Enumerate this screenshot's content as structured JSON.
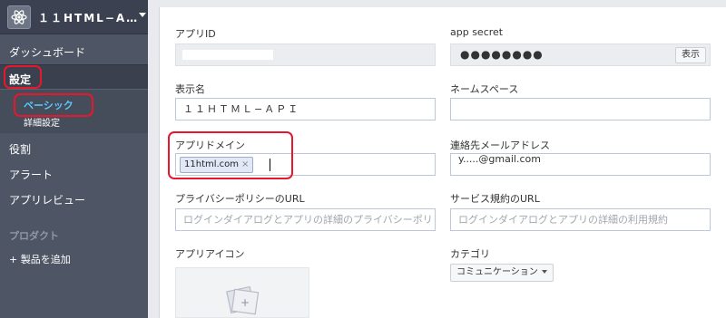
{
  "sidebar": {
    "app_name": "１１HTML−A…",
    "dashboard": "ダッシュボード",
    "settings": "設定",
    "settings_sub": [
      "ベーシック",
      "詳細設定"
    ],
    "roles": "役割",
    "alerts": "アラート",
    "app_review": "アプリレビュー",
    "products_header": "プロダクト",
    "add_product": "+ 製品を追加"
  },
  "form": {
    "app_id": {
      "label": "アプリID",
      "value": ""
    },
    "app_secret": {
      "label": "app secret",
      "value": "●●●●●●●●",
      "show_button": "表示"
    },
    "display_name": {
      "label": "表示名",
      "value": "１１ＨＴＭＬ−ＡＰＩ"
    },
    "namespace": {
      "label": "ネームスペース",
      "value": ""
    },
    "app_domain": {
      "label": "アプリドメイン",
      "tokens": [
        "11html.com"
      ]
    },
    "contact_email": {
      "label": "連絡先メールアドレス",
      "value": "y.....@gmail.com"
    },
    "privacy_url": {
      "label": "プライバシーポリシーのURL",
      "placeholder": "ログインダイアログとアプリの詳細のプライバシーポリ"
    },
    "tos_url": {
      "label": "サービス規約のURL",
      "placeholder": "ログインダイアログとアプリの詳細の利用規約"
    },
    "app_icon": {
      "label": "アプリアイコン"
    },
    "category": {
      "label": "カテゴリ",
      "value": "コミュニケーション"
    }
  },
  "colors": {
    "annotation": "#e8172c",
    "sidebar_bg": "#4e5665",
    "active_item": "#5cc8ff"
  }
}
